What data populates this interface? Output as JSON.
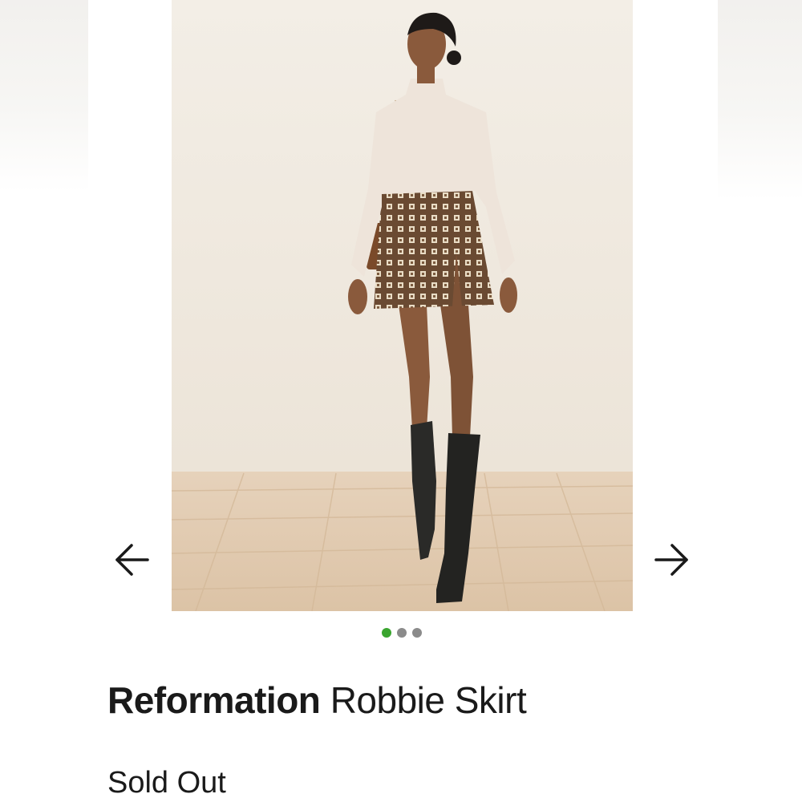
{
  "product": {
    "brand": "Reformation",
    "name": "Robbie Skirt",
    "status": "Sold Out"
  },
  "gallery": {
    "image_label": "Model wearing Reformation Robbie Skirt",
    "image_count": 3,
    "active_index": 0,
    "prev_icon": "arrow-left-icon",
    "next_icon": "arrow-right-icon"
  },
  "colors": {
    "active_dot": "#3aa52f",
    "inactive_dot": "#8b8b8b",
    "text": "#1a1a1a"
  }
}
